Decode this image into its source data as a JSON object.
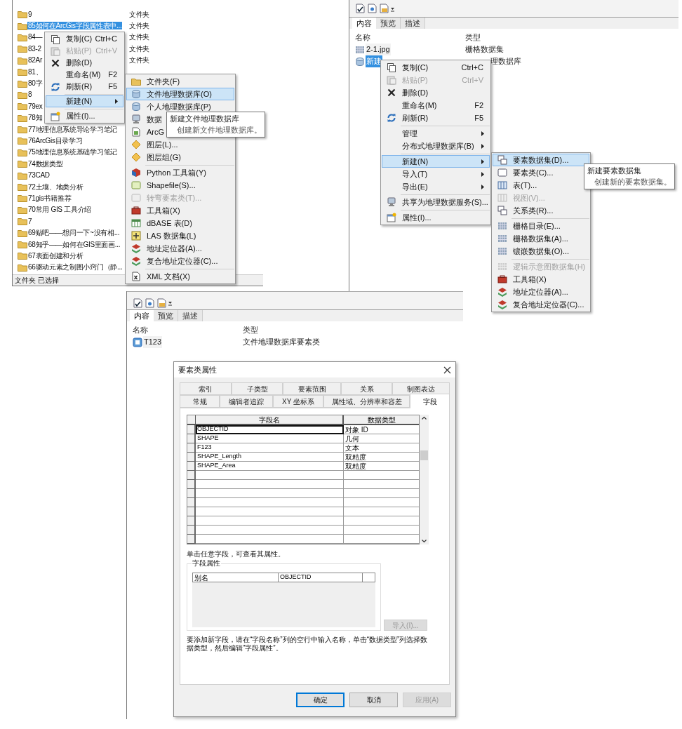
{
  "explorer": {
    "folders": [
      {
        "name": "9",
        "type": "文件夹",
        "selected": false
      },
      {
        "name": "85如何在ArcGis字段属性表中...",
        "type": "文件夹",
        "selected": true
      },
      {
        "name": "84—",
        "type": "文件夹",
        "selected": false
      },
      {
        "name": "83-2",
        "type": "文件夹",
        "selected": false
      },
      {
        "name": "82Ar",
        "type": "文件夹",
        "selected": false
      },
      {
        "name": "81、",
        "selected": false
      },
      {
        "name": "80字",
        "selected": false
      },
      {
        "name": "8",
        "selected": false
      },
      {
        "name": "79ex",
        "selected": false
      },
      {
        "name": "78知",
        "selected": false
      },
      {
        "name": "77地理信息系统导论学习笔记",
        "selected": false
      },
      {
        "name": "76ArcGis目录学习",
        "selected": false
      },
      {
        "name": "75地理信息系统基础学习笔记",
        "selected": false
      },
      {
        "name": "74数据类型",
        "selected": false
      },
      {
        "name": "73CAD",
        "selected": false
      },
      {
        "name": "72土壤、地类分析",
        "selected": false
      },
      {
        "name": "71gis书籍推荐",
        "selected": false
      },
      {
        "name": "70常用 GIS 工具介绍",
        "selected": false
      },
      {
        "name": "7",
        "selected": false
      },
      {
        "name": "69贴吧——想问一下~没有相...",
        "selected": false
      },
      {
        "name": "68知乎——如何在GIS里面画...",
        "selected": false
      },
      {
        "name": "67表面创建和分析",
        "selected": false
      },
      {
        "name": "66驱动元素之制图小窍门（静...",
        "selected": false
      }
    ],
    "status": "文件夹 已选择"
  },
  "explorer_menu": {
    "items": [
      {
        "kind": "item",
        "label": "复制(C)",
        "shortcut": "Ctrl+C",
        "submenu": false,
        "disabled": false,
        "selected": false
      },
      {
        "kind": "item",
        "label": "粘贴(P)",
        "shortcut": "Ctrl+V",
        "submenu": false,
        "disabled": true,
        "selected": false
      },
      {
        "kind": "item",
        "label": "删除(D)",
        "submenu": false,
        "disabled": false,
        "selected": false
      },
      {
        "kind": "item",
        "label": "重命名(M)",
        "shortcut": "F2",
        "submenu": false,
        "disabled": false,
        "selected": false
      },
      {
        "kind": "item",
        "label": "刷新(R)",
        "shortcut": "F5",
        "submenu": false,
        "disabled": false,
        "selected": false
      },
      {
        "kind": "separator"
      },
      {
        "kind": "item",
        "label": "新建(N)",
        "submenu": true,
        "disabled": false,
        "selected": true
      },
      {
        "kind": "separator"
      },
      {
        "kind": "item",
        "label": "属性(I)...",
        "submenu": false,
        "disabled": false,
        "selected": false
      }
    ]
  },
  "explorer_submenu": {
    "items": [
      {
        "kind": "item",
        "label": "文件夹(F)",
        "submenu": false,
        "disabled": false,
        "selected": false
      },
      {
        "kind": "item",
        "label": "文件地理数据库(O)",
        "submenu": false,
        "disabled": false,
        "selected": true
      },
      {
        "kind": "item",
        "label": "个人地理数据库(P)",
        "submenu": false,
        "disabled": false,
        "selected": false
      },
      {
        "kind": "item",
        "label": "数据",
        "disabled": false,
        "selected": false
      },
      {
        "kind": "item",
        "label": "ArcG",
        "disabled": false,
        "selected": false
      },
      {
        "kind": "item",
        "label": "图层(L)...",
        "submenu": false,
        "disabled": false,
        "selected": false
      },
      {
        "kind": "item",
        "label": "图层组(G)",
        "submenu": false,
        "disabled": false,
        "selected": false
      },
      {
        "kind": "separator"
      },
      {
        "kind": "item",
        "label": "Python 工具箱(Y)",
        "submenu": false,
        "disabled": false,
        "selected": false
      },
      {
        "kind": "item",
        "label": "Shapefile(S)...",
        "submenu": false,
        "disabled": false,
        "selected": false
      },
      {
        "kind": "item",
        "label": "转弯要素类(T)...",
        "submenu": false,
        "disabled": true,
        "selected": false
      },
      {
        "kind": "item",
        "label": "工具箱(X)",
        "submenu": false,
        "disabled": false,
        "selected": false
      },
      {
        "kind": "item",
        "label": "dBASE 表(D)",
        "submenu": false,
        "disabled": false,
        "selected": false
      },
      {
        "kind": "item",
        "label": "LAS 数据集(L)",
        "submenu": false,
        "disabled": false,
        "selected": false
      },
      {
        "kind": "item",
        "label": "地址定位器(A)...",
        "submenu": false,
        "disabled": false,
        "selected": false
      },
      {
        "kind": "item",
        "label": "复合地址定位器(C)...",
        "submenu": false,
        "disabled": false,
        "selected": false
      },
      {
        "kind": "separator"
      },
      {
        "kind": "item",
        "label": "XML 文档(X)",
        "submenu": false,
        "disabled": false,
        "selected": false
      }
    ]
  },
  "explorer_tooltip": {
    "title": "新建文件地理数据库",
    "description": "创建新文件地理数据库。"
  },
  "catalog_top": {
    "tabs": [
      {
        "label": "内容",
        "selected": true
      },
      {
        "label": "预览",
        "selected": false
      },
      {
        "label": "描述",
        "selected": false
      }
    ],
    "columns": [
      "名称",
      "类型"
    ],
    "rows": [
      {
        "name": "2-1.jpg",
        "type": "栅格数据集",
        "selected": false
      },
      {
        "name": "新建",
        "type": "理数据库",
        "selected": true
      }
    ]
  },
  "catalog_menu": {
    "items": [
      {
        "kind": "item",
        "label": "复制(C)",
        "shortcut": "Ctrl+C",
        "submenu": false,
        "disabled": false,
        "selected": false
      },
      {
        "kind": "item",
        "label": "粘贴(P)",
        "shortcut": "Ctrl+V",
        "submenu": false,
        "disabled": true,
        "selected": false
      },
      {
        "kind": "item",
        "label": "删除(D)",
        "submenu": false,
        "disabled": false,
        "selected": false
      },
      {
        "kind": "item",
        "label": "重命名(M)",
        "shortcut": "F2",
        "submenu": false,
        "disabled": false,
        "selected": false
      },
      {
        "kind": "item",
        "label": "刷新(R)",
        "shortcut": "F5",
        "submenu": false,
        "disabled": false,
        "selected": false
      },
      {
        "kind": "separator"
      },
      {
        "kind": "item",
        "label": "管理",
        "submenu": true,
        "disabled": false,
        "selected": false
      },
      {
        "kind": "item",
        "label": "分布式地理数据库(B)",
        "submenu": true,
        "disabled": false,
        "selected": false
      },
      {
        "kind": "separator"
      },
      {
        "kind": "item",
        "label": "新建(N)",
        "submenu": true,
        "disabled": false,
        "selected": true
      },
      {
        "kind": "item",
        "label": "导入(T)",
        "submenu": true,
        "disabled": false,
        "selected": false
      },
      {
        "kind": "item",
        "label": "导出(E)",
        "submenu": true,
        "disabled": false,
        "selected": false
      },
      {
        "kind": "separator"
      },
      {
        "kind": "item",
        "label": "共享为地理数据服务(S)...",
        "submenu": false,
        "disabled": false,
        "selected": false
      },
      {
        "kind": "separator"
      },
      {
        "kind": "item",
        "label": "属性(I)...",
        "submenu": false,
        "disabled": false,
        "selected": false
      }
    ]
  },
  "catalog_submenu": {
    "items": [
      {
        "kind": "item",
        "label": "要素数据集(D)...",
        "submenu": false,
        "disabled": false,
        "selected": true
      },
      {
        "kind": "item",
        "label": "要素类(C)...",
        "submenu": false,
        "disabled": false,
        "selected": false
      },
      {
        "kind": "item",
        "label": "表(T)...",
        "submenu": false,
        "disabled": false,
        "selected": false
      },
      {
        "kind": "item",
        "label": "视图(V)...",
        "submenu": false,
        "disabled": true,
        "selected": false
      },
      {
        "kind": "item",
        "label": "关系类(R)...",
        "submenu": false,
        "disabled": false,
        "selected": false
      },
      {
        "kind": "separator"
      },
      {
        "kind": "item",
        "label": "栅格目录(E)...",
        "submenu": false,
        "disabled": false,
        "selected": false
      },
      {
        "kind": "item",
        "label": "栅格数据集(A)...",
        "submenu": false,
        "disabled": false,
        "selected": false
      },
      {
        "kind": "item",
        "label": "镶嵌数据集(O)...",
        "submenu": false,
        "disabled": false,
        "selected": false
      },
      {
        "kind": "separator"
      },
      {
        "kind": "item",
        "label": "逻辑示意图数据集(H)",
        "submenu": false,
        "disabled": true,
        "selected": false
      },
      {
        "kind": "item",
        "label": "工具箱(X)",
        "submenu": false,
        "disabled": false,
        "selected": false
      },
      {
        "kind": "item",
        "label": "地址定位器(A)...",
        "submenu": false,
        "disabled": false,
        "selected": false
      },
      {
        "kind": "item",
        "label": "复合地址定位器(C)...",
        "submenu": false,
        "disabled": false,
        "selected": false
      }
    ]
  },
  "catalog_tooltip": {
    "title": "新建要素数据集",
    "description": "创建新的要素数据集。"
  },
  "catalog_bottom": {
    "tabs": [
      {
        "label": "内容",
        "selected": true
      },
      {
        "label": "预览",
        "selected": false
      },
      {
        "label": "描述",
        "selected": false
      }
    ],
    "columns": [
      "名称",
      "类型"
    ],
    "rows": [
      {
        "name": "T123",
        "type": "文件地理数据库要素类",
        "selected": false
      }
    ]
  },
  "dialog": {
    "title": "要素类属性",
    "tab_rows": [
      {
        "tabs": [
          {
            "label": "索引",
            "selected": false
          },
          {
            "label": "子类型",
            "selected": false
          },
          {
            "label": "要素范围",
            "selected": false
          },
          {
            "label": "关系",
            "selected": false
          },
          {
            "label": "制图表达",
            "selected": false
          }
        ]
      },
      {
        "tabs": [
          {
            "label": "常规",
            "selected": false
          },
          {
            "label": "编辑者追踪",
            "selected": false
          },
          {
            "label": "XY 坐标系",
            "selected": false
          },
          {
            "label": "属性域、分辨率和容差",
            "selected": false
          },
          {
            "label": "字段",
            "selected": true
          }
        ]
      }
    ],
    "columns": [
      "字段名",
      "数据类型"
    ],
    "fields": [
      {
        "name": "OBJECTID",
        "type": "对象 ID",
        "selected": true
      },
      {
        "name": "SHAPE",
        "type": "几何",
        "selected": false
      },
      {
        "name": "F123",
        "type": "文本",
        "selected": false
      },
      {
        "name": "SHAPE_Length",
        "type": "双精度",
        "selected": false
      },
      {
        "name": "SHAPE_Area",
        "type": "双精度",
        "selected": false
      }
    ],
    "hint": "单击任意字段，可查看其属性。",
    "field_properties": {
      "title": "字段属性",
      "rows": [
        {
          "property": "别名",
          "value": "OBJECTID"
        }
      ]
    },
    "import_button": {
      "label": "导入(I)...",
      "disabled": true
    },
    "note": "要添加新字段，请在“字段名称”列的空行中输入名称，单击“数据类型”列选择数据类型，然后编辑“字段属性”。",
    "buttons": [
      {
        "label": "确定",
        "default": true,
        "disabled": false
      },
      {
        "label": "取消",
        "default": false,
        "disabled": false
      },
      {
        "label": "应用(A)",
        "default": false,
        "disabled": true
      }
    ]
  }
}
